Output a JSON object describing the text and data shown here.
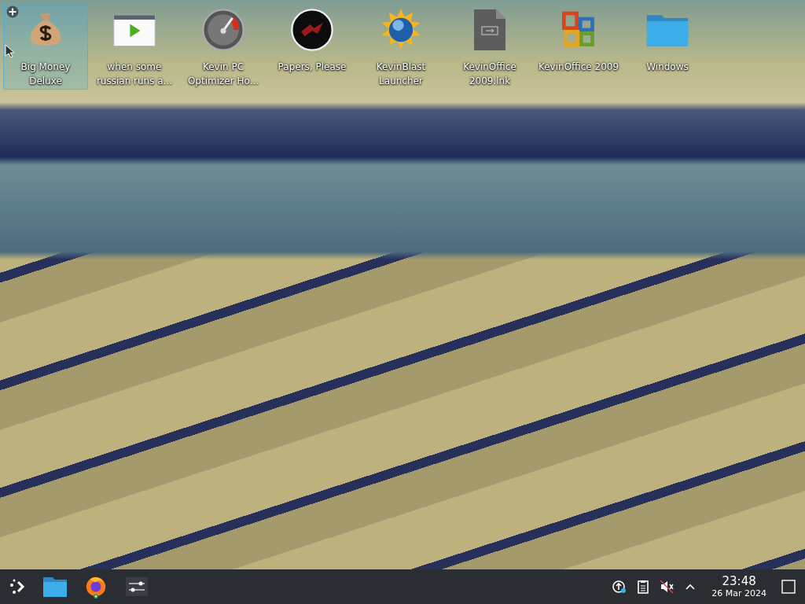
{
  "desktop_icons": [
    {
      "label": "Big Money Deluxe",
      "kind": "money-bag",
      "selected": true
    },
    {
      "label": "when some russian runs a...",
      "kind": "video",
      "selected": false
    },
    {
      "label": "Kevin PC Optimizer Ho...",
      "kind": "gauge",
      "selected": false
    },
    {
      "label": "Papers, Please",
      "kind": "seal",
      "selected": false
    },
    {
      "label": "KevinBlast Launcher",
      "kind": "sun-globe",
      "selected": false
    },
    {
      "label": "KevinOffice 2009.lnk",
      "kind": "shortcut-file",
      "selected": false
    },
    {
      "label": "KevinOffice 2009",
      "kind": "office",
      "selected": false
    },
    {
      "label": "Windows",
      "kind": "folder",
      "selected": false
    }
  ],
  "taskbar": {
    "tasks": [
      {
        "kind": "folder"
      },
      {
        "kind": "browser"
      },
      {
        "kind": "sliders"
      }
    ],
    "tray": [
      {
        "kind": "update"
      },
      {
        "kind": "clipboard"
      },
      {
        "kind": "muted"
      },
      {
        "kind": "chevron"
      }
    ],
    "clock": {
      "time": "23:48",
      "date": "26 Mar 2024"
    }
  }
}
